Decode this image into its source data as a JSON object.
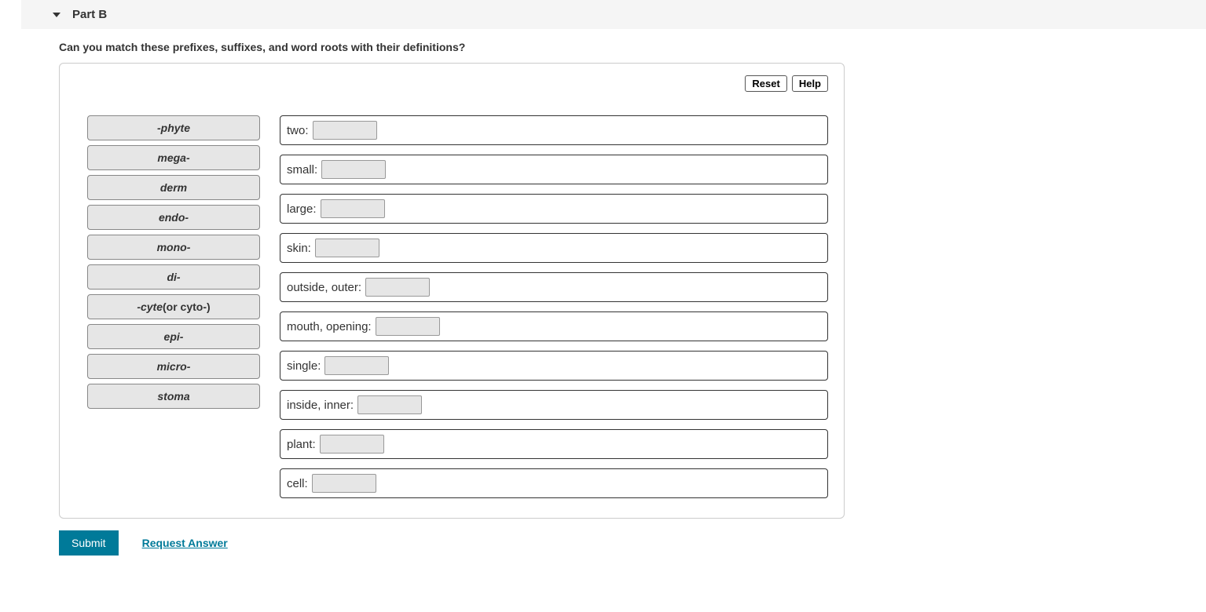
{
  "header": {
    "title": "Part B"
  },
  "prompt": "Can you match these prefixes, suffixes, and word roots with their definitions?",
  "buttons": {
    "reset": "Reset",
    "help": "Help",
    "submit": "Submit",
    "request": "Request Answer"
  },
  "terms": [
    {
      "label": "-phyte",
      "plain": ""
    },
    {
      "label": "mega-",
      "plain": ""
    },
    {
      "label": "derm",
      "plain": ""
    },
    {
      "label": "endo-",
      "plain": ""
    },
    {
      "label": "mono-",
      "plain": ""
    },
    {
      "label": "di-",
      "plain": ""
    },
    {
      "label": "-cyte",
      "plain": " (or cyto-)"
    },
    {
      "label": "epi-",
      "plain": ""
    },
    {
      "label": "micro-",
      "plain": ""
    },
    {
      "label": "stoma",
      "plain": ""
    }
  ],
  "definitions": [
    "two:",
    "small:",
    "large:",
    "skin:",
    "outside, outer:",
    "mouth, opening:",
    "single:",
    "inside, inner:",
    "plant:",
    "cell:"
  ]
}
